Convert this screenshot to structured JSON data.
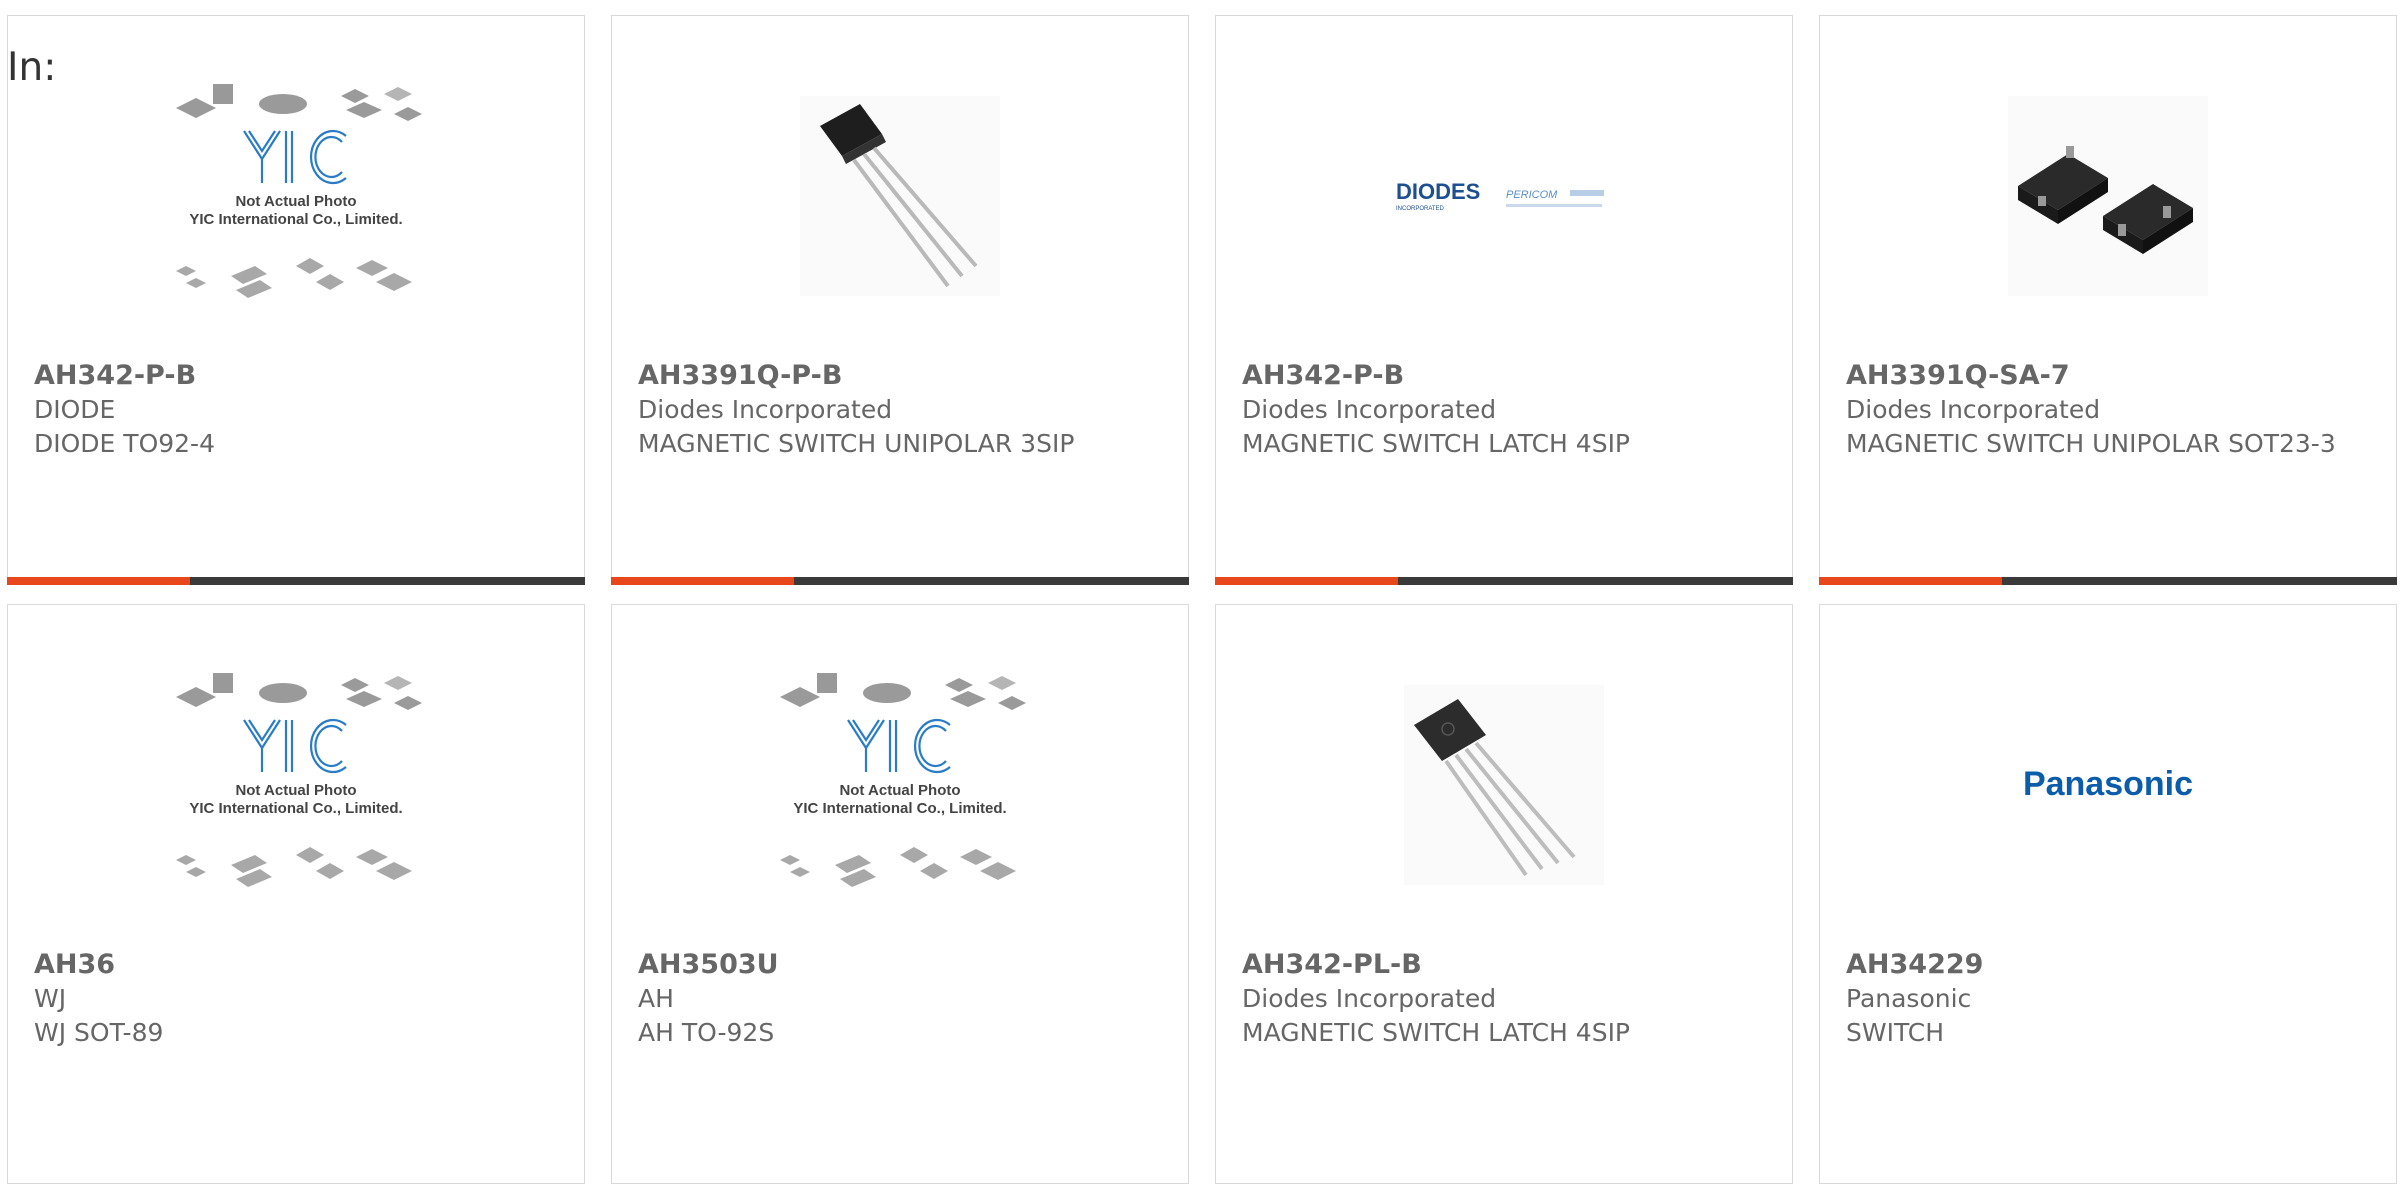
{
  "filter": {
    "label": "In:"
  },
  "products": [
    {
      "part": "AH342-P-B",
      "manufacturer": "DIODE",
      "description": "DIODE TO92-4",
      "image": "placeholder-photo"
    },
    {
      "part": "AH3391Q-P-B",
      "manufacturer": "Diodes Incorporated",
      "description": "MAGNETIC SWITCH UNIPOLAR 3SIP",
      "image": "to92-3pin-photo"
    },
    {
      "part": "AH342-P-B",
      "manufacturer": "Diodes Incorporated",
      "description": "MAGNETIC SWITCH LATCH 4SIP",
      "image": "diodes-logo"
    },
    {
      "part": "AH3391Q-SA-7",
      "manufacturer": "Diodes Incorporated",
      "description": "MAGNETIC SWITCH UNIPOLAR SOT23-3",
      "image": "sot23-photo"
    },
    {
      "part": "AH36",
      "manufacturer": "WJ",
      "description": "WJ SOT-89",
      "image": "placeholder-photo"
    },
    {
      "part": "AH3503U",
      "manufacturer": "AH",
      "description": "AH TO-92S",
      "image": "placeholder-photo"
    },
    {
      "part": "AH342-PL-B",
      "manufacturer": "Diodes Incorporated",
      "description": "MAGNETIC SWITCH LATCH 4SIP",
      "image": "to92-4pin-photo"
    },
    {
      "part": "AH34229",
      "manufacturer": "Panasonic",
      "description": "SWITCH",
      "image": "panasonic-logo"
    }
  ],
  "placeholder": {
    "logo_text": "YIC",
    "caption_line1": "Not Actual Photo",
    "caption_line2": "YIC International Co., Limited."
  },
  "logos": {
    "diodes": "DIODES",
    "diodes_sub": "INCORPORATED",
    "pericom": "PERICOM",
    "panasonic": "Panasonic"
  },
  "colors": {
    "accent": "#e8461b",
    "bar": "#3a3a3a",
    "yic_blue": "#2a7cc7",
    "panasonic_blue": "#0b5cab",
    "diodes_blue": "#1d4f91"
  }
}
